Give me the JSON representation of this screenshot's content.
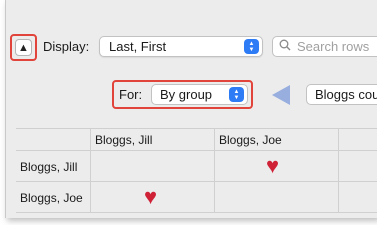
{
  "toolbar": {
    "collapse_icon": "chevron-up-icon",
    "display_label": "Display:",
    "display_value": "Last, First",
    "search_placeholder": "Search rows",
    "for_label": "For:",
    "for_value": "By group",
    "person_value": "Bloggs cou"
  },
  "grid": {
    "columns": [
      "Bloggs, Jill",
      "Bloggs, Joe"
    ],
    "rows": [
      {
        "label": "Bloggs, Jill",
        "cells": [
          "",
          "heart"
        ]
      },
      {
        "label": "Bloggs, Joe",
        "cells": [
          "heart",
          ""
        ]
      }
    ]
  },
  "colors": {
    "highlight": "#e0443a",
    "accent": "#2e7bf6",
    "heart": "#cf2237",
    "arrow": "#97aede"
  }
}
